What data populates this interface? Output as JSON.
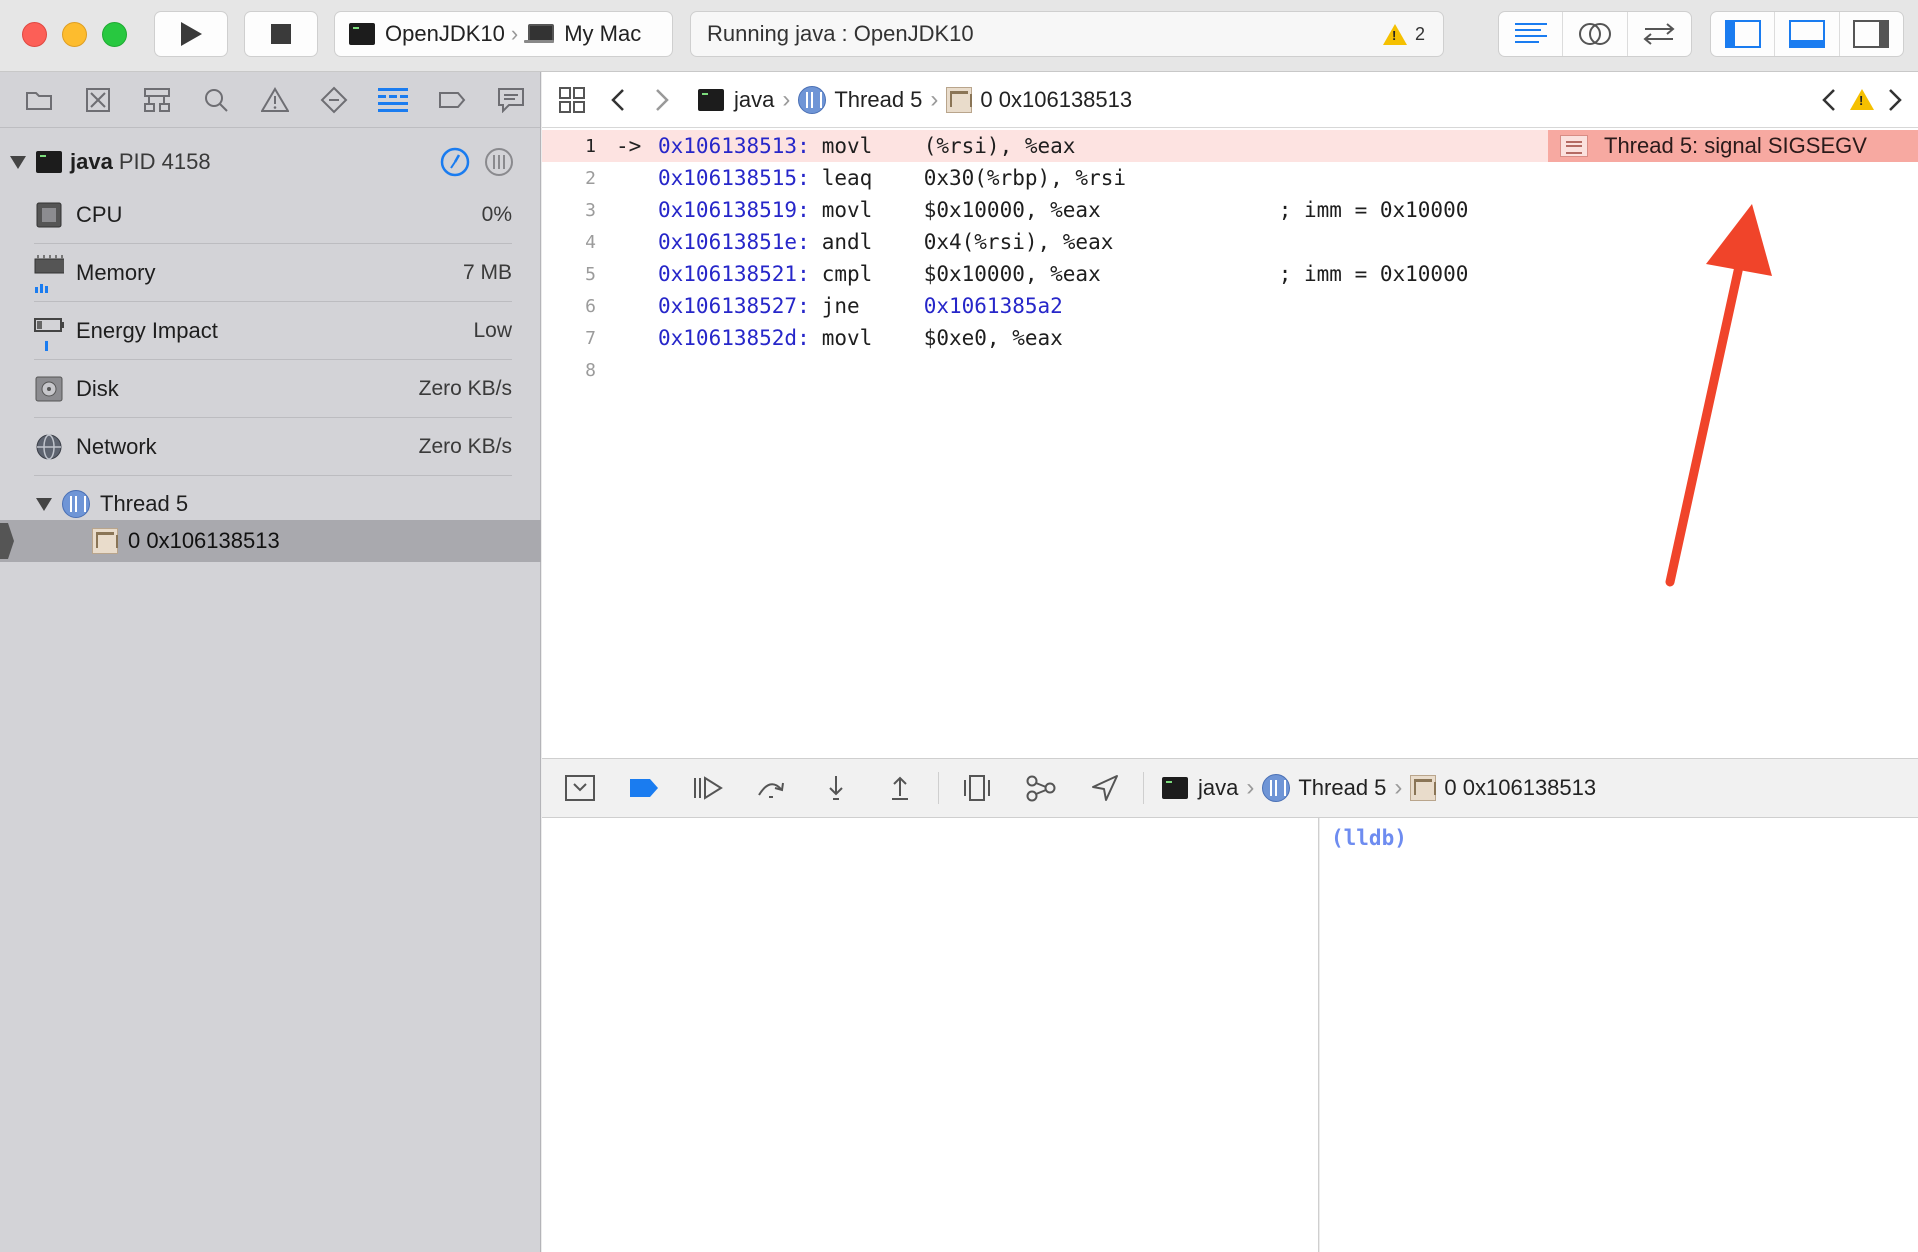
{
  "toolbar": {
    "scheme_target": "OpenJDK10",
    "scheme_device": "My Mac",
    "activity_status": "Running java : OpenJDK10",
    "warning_count": "2"
  },
  "navigator": {
    "process_name": "java",
    "process_pid": "PID 4158",
    "gauges": [
      {
        "label": "CPU",
        "value": "0%"
      },
      {
        "label": "Memory",
        "value": "7 MB"
      },
      {
        "label": "Energy Impact",
        "value": "Low"
      },
      {
        "label": "Disk",
        "value": "Zero KB/s"
      },
      {
        "label": "Network",
        "value": "Zero KB/s"
      }
    ],
    "thread_label": "Thread 5",
    "frame_label": "0 0x106138513"
  },
  "editor": {
    "breadcrumb": {
      "process": "java",
      "thread": "Thread 5",
      "frame": "0 0x106138513"
    },
    "signal_badge": "Thread 5: signal SIGSEGV",
    "pc_marker": "->",
    "lines": [
      {
        "num": "1",
        "addr": "0x106138513:",
        "op": "movl",
        "operands": "(%rsi), %eax",
        "comment": ""
      },
      {
        "num": "2",
        "addr": "0x106138515:",
        "op": "leaq",
        "operands": "0x30(%rbp), %rsi",
        "comment": ""
      },
      {
        "num": "3",
        "addr": "0x106138519:",
        "op": "movl",
        "operands": "$0x10000, %eax",
        "comment": "; imm = 0x10000"
      },
      {
        "num": "4",
        "addr": "0x10613851e:",
        "op": "andl",
        "operands": "0x4(%rsi), %eax",
        "comment": ""
      },
      {
        "num": "5",
        "addr": "0x106138521:",
        "op": "cmpl",
        "operands": "$0x10000, %eax",
        "comment": "; imm = 0x10000"
      },
      {
        "num": "6",
        "addr": "0x106138527:",
        "op": "jne",
        "operands": "0x1061385a2",
        "comment": ""
      },
      {
        "num": "7",
        "addr": "0x10613852d:",
        "op": "movl",
        "operands": "$0xe0, %eax",
        "comment": ""
      },
      {
        "num": "8",
        "addr": "",
        "op": "",
        "operands": "",
        "comment": ""
      }
    ]
  },
  "debugbar": {
    "process": "java",
    "thread": "Thread 5",
    "frame": "0 0x106138513"
  },
  "console": {
    "prompt": "(lldb)"
  },
  "colors": {
    "accent": "#1a7cf0",
    "error_highlight": "#fde3e1",
    "signal_badge": "#f7a9a1",
    "annotation_arrow": "#f0442a"
  }
}
